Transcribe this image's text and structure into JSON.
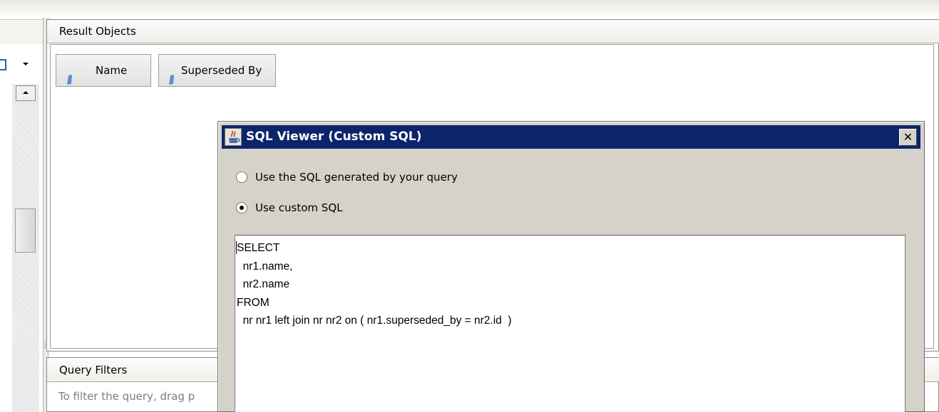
{
  "result_objects": {
    "title": "Result Objects",
    "objects": [
      {
        "label": "Name"
      },
      {
        "label": "Superseded By"
      }
    ]
  },
  "query_filters": {
    "title": "Query Filters",
    "hint": "To filter the query, drag p"
  },
  "dialog": {
    "title": "SQL Viewer (Custom SQL)",
    "close_label": "✕",
    "options": [
      {
        "label": "Use the SQL generated by your query",
        "selected": false
      },
      {
        "label": "Use custom SQL",
        "selected": true
      }
    ],
    "sql": "SELECT\n  nr1.name,\n  nr2.name\nFROM\n  nr nr1 left join nr nr2 on ( nr1.superseded_by = nr2.id  )"
  },
  "icons": {
    "object_dimension": "dimension-icon",
    "java_app": "java-cup-icon",
    "dropdown": "chevron-down-icon",
    "scroll_up": "scroll-up-arrow-icon"
  },
  "colors": {
    "titlebar": "#0b246b",
    "dialog_bg": "#d5d2ca",
    "dimension_blue": "#5b8fd6"
  }
}
